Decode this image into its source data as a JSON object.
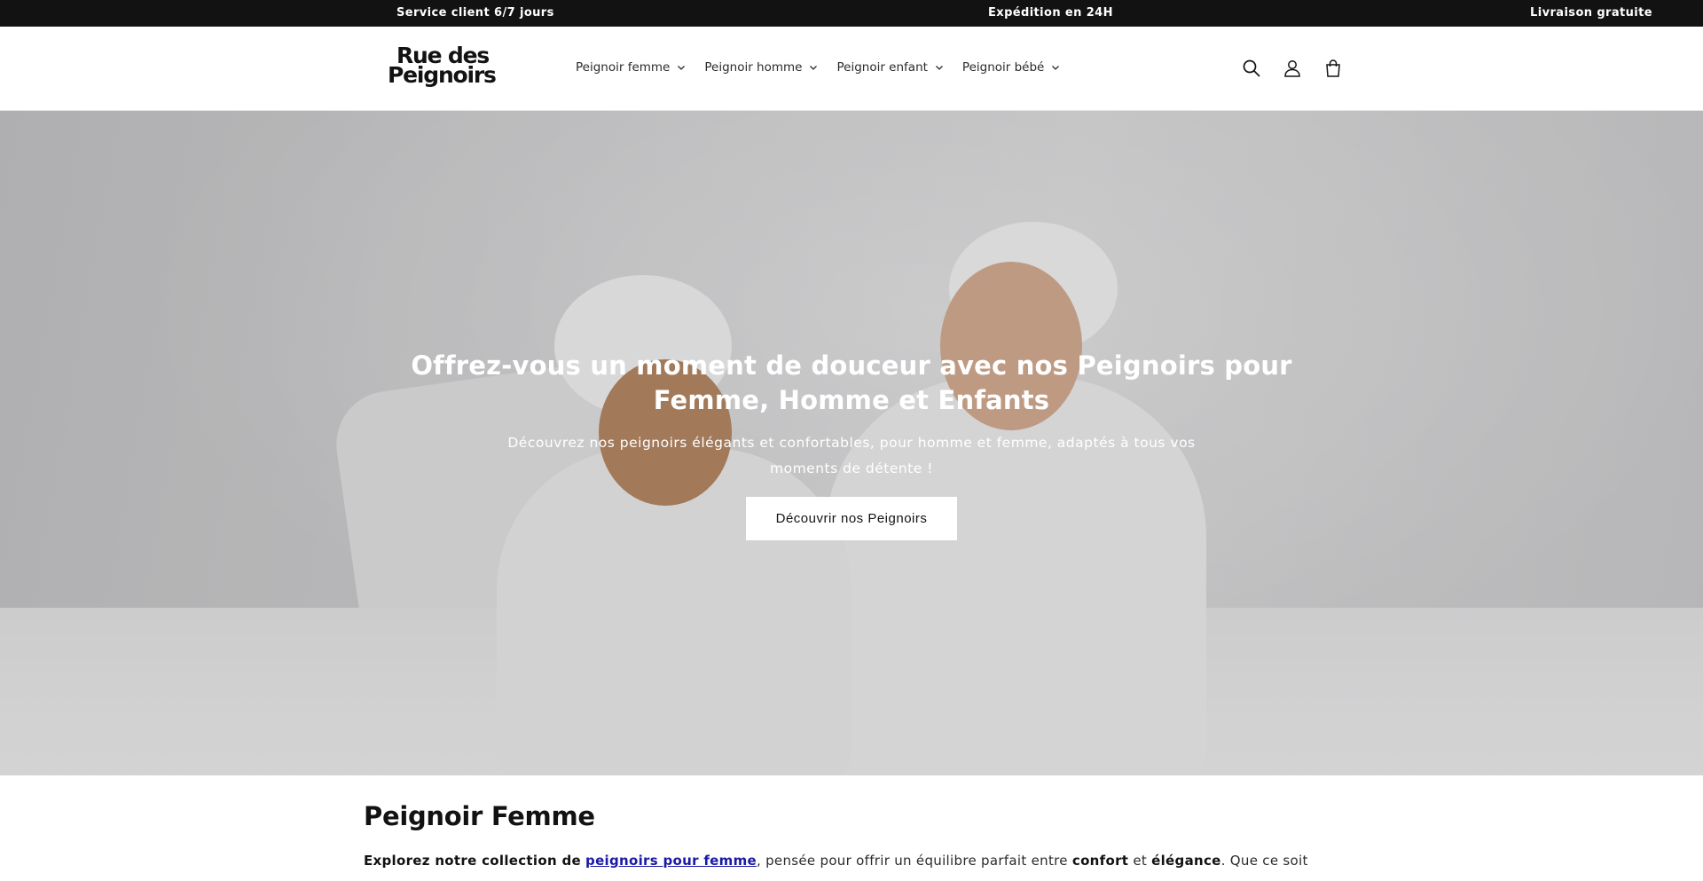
{
  "announcement": {
    "items": [
      "Service client 6/7 jours",
      "Expédition en 24H",
      "Livraison gratuite"
    ]
  },
  "header": {
    "logo": {
      "line1": "Rue des",
      "line2": "Peignoirs"
    },
    "nav": [
      {
        "label": "Peignoir femme",
        "icon": "chevron-down-icon"
      },
      {
        "label": "Peignoir homme",
        "icon": "chevron-down-icon"
      },
      {
        "label": "Peignoir enfant",
        "icon": "chevron-down-icon"
      },
      {
        "label": "Peignoir bébé",
        "icon": "chevron-down-icon"
      }
    ],
    "icons": [
      "search-icon",
      "account-icon",
      "cart-icon"
    ]
  },
  "hero": {
    "title": "Offrez-vous un moment de douceur avec nos Peignoirs pour Femme, Homme et Enfants",
    "subtitle": "Découvrez nos peignoirs élégants et confortables, pour homme et femme, adaptés à tous vos moments de détente !",
    "button_label": "Découvrir nos Peignoirs"
  },
  "section": {
    "heading": "Peignoir Femme",
    "intro_1": "Explorez notre collection de",
    "link_text": "peignoirs pour femme",
    "intro_2": ", pensée pour offrir un équilibre parfait entre",
    "bold_1": "confort",
    "intro_3": "et",
    "bold_2": "élégance",
    "intro_4": ". Que ce soit pour sortir du"
  },
  "colors": {
    "announcement_bg": "#121212",
    "text": "#121212",
    "link": "#1a1aa6",
    "button_bg": "#ffffff"
  }
}
